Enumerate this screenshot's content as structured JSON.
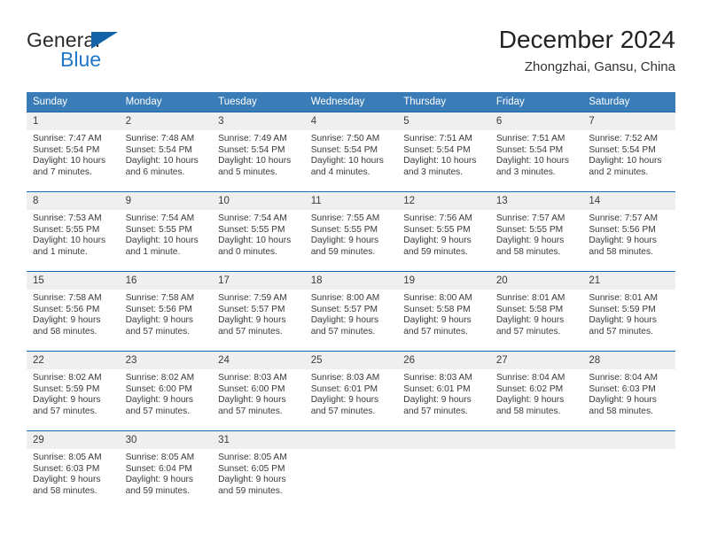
{
  "brand": {
    "name_part1": "General",
    "name_part2": "Blue",
    "accent_color": "#2176c7",
    "triangle_color": "#1263a8"
  },
  "header": {
    "title": "December 2024",
    "subtitle": "Zhongzhai, Gansu, China"
  },
  "calendar": {
    "header_bg": "#3a7cb8",
    "row_divider_color": "#1a69ad",
    "daynum_bg": "#efefef",
    "weekdays": [
      "Sunday",
      "Monday",
      "Tuesday",
      "Wednesday",
      "Thursday",
      "Friday",
      "Saturday"
    ],
    "weeks": [
      [
        {
          "day": "1",
          "sunrise": "Sunrise: 7:47 AM",
          "sunset": "Sunset: 5:54 PM",
          "daylight": "Daylight: 10 hours and 7 minutes."
        },
        {
          "day": "2",
          "sunrise": "Sunrise: 7:48 AM",
          "sunset": "Sunset: 5:54 PM",
          "daylight": "Daylight: 10 hours and 6 minutes."
        },
        {
          "day": "3",
          "sunrise": "Sunrise: 7:49 AM",
          "sunset": "Sunset: 5:54 PM",
          "daylight": "Daylight: 10 hours and 5 minutes."
        },
        {
          "day": "4",
          "sunrise": "Sunrise: 7:50 AM",
          "sunset": "Sunset: 5:54 PM",
          "daylight": "Daylight: 10 hours and 4 minutes."
        },
        {
          "day": "5",
          "sunrise": "Sunrise: 7:51 AM",
          "sunset": "Sunset: 5:54 PM",
          "daylight": "Daylight: 10 hours and 3 minutes."
        },
        {
          "day": "6",
          "sunrise": "Sunrise: 7:51 AM",
          "sunset": "Sunset: 5:54 PM",
          "daylight": "Daylight: 10 hours and 3 minutes."
        },
        {
          "day": "7",
          "sunrise": "Sunrise: 7:52 AM",
          "sunset": "Sunset: 5:54 PM",
          "daylight": "Daylight: 10 hours and 2 minutes."
        }
      ],
      [
        {
          "day": "8",
          "sunrise": "Sunrise: 7:53 AM",
          "sunset": "Sunset: 5:55 PM",
          "daylight": "Daylight: 10 hours and 1 minute."
        },
        {
          "day": "9",
          "sunrise": "Sunrise: 7:54 AM",
          "sunset": "Sunset: 5:55 PM",
          "daylight": "Daylight: 10 hours and 1 minute."
        },
        {
          "day": "10",
          "sunrise": "Sunrise: 7:54 AM",
          "sunset": "Sunset: 5:55 PM",
          "daylight": "Daylight: 10 hours and 0 minutes."
        },
        {
          "day": "11",
          "sunrise": "Sunrise: 7:55 AM",
          "sunset": "Sunset: 5:55 PM",
          "daylight": "Daylight: 9 hours and 59 minutes."
        },
        {
          "day": "12",
          "sunrise": "Sunrise: 7:56 AM",
          "sunset": "Sunset: 5:55 PM",
          "daylight": "Daylight: 9 hours and 59 minutes."
        },
        {
          "day": "13",
          "sunrise": "Sunrise: 7:57 AM",
          "sunset": "Sunset: 5:55 PM",
          "daylight": "Daylight: 9 hours and 58 minutes."
        },
        {
          "day": "14",
          "sunrise": "Sunrise: 7:57 AM",
          "sunset": "Sunset: 5:56 PM",
          "daylight": "Daylight: 9 hours and 58 minutes."
        }
      ],
      [
        {
          "day": "15",
          "sunrise": "Sunrise: 7:58 AM",
          "sunset": "Sunset: 5:56 PM",
          "daylight": "Daylight: 9 hours and 58 minutes."
        },
        {
          "day": "16",
          "sunrise": "Sunrise: 7:58 AM",
          "sunset": "Sunset: 5:56 PM",
          "daylight": "Daylight: 9 hours and 57 minutes."
        },
        {
          "day": "17",
          "sunrise": "Sunrise: 7:59 AM",
          "sunset": "Sunset: 5:57 PM",
          "daylight": "Daylight: 9 hours and 57 minutes."
        },
        {
          "day": "18",
          "sunrise": "Sunrise: 8:00 AM",
          "sunset": "Sunset: 5:57 PM",
          "daylight": "Daylight: 9 hours and 57 minutes."
        },
        {
          "day": "19",
          "sunrise": "Sunrise: 8:00 AM",
          "sunset": "Sunset: 5:58 PM",
          "daylight": "Daylight: 9 hours and 57 minutes."
        },
        {
          "day": "20",
          "sunrise": "Sunrise: 8:01 AM",
          "sunset": "Sunset: 5:58 PM",
          "daylight": "Daylight: 9 hours and 57 minutes."
        },
        {
          "day": "21",
          "sunrise": "Sunrise: 8:01 AM",
          "sunset": "Sunset: 5:59 PM",
          "daylight": "Daylight: 9 hours and 57 minutes."
        }
      ],
      [
        {
          "day": "22",
          "sunrise": "Sunrise: 8:02 AM",
          "sunset": "Sunset: 5:59 PM",
          "daylight": "Daylight: 9 hours and 57 minutes."
        },
        {
          "day": "23",
          "sunrise": "Sunrise: 8:02 AM",
          "sunset": "Sunset: 6:00 PM",
          "daylight": "Daylight: 9 hours and 57 minutes."
        },
        {
          "day": "24",
          "sunrise": "Sunrise: 8:03 AM",
          "sunset": "Sunset: 6:00 PM",
          "daylight": "Daylight: 9 hours and 57 minutes."
        },
        {
          "day": "25",
          "sunrise": "Sunrise: 8:03 AM",
          "sunset": "Sunset: 6:01 PM",
          "daylight": "Daylight: 9 hours and 57 minutes."
        },
        {
          "day": "26",
          "sunrise": "Sunrise: 8:03 AM",
          "sunset": "Sunset: 6:01 PM",
          "daylight": "Daylight: 9 hours and 57 minutes."
        },
        {
          "day": "27",
          "sunrise": "Sunrise: 8:04 AM",
          "sunset": "Sunset: 6:02 PM",
          "daylight": "Daylight: 9 hours and 58 minutes."
        },
        {
          "day": "28",
          "sunrise": "Sunrise: 8:04 AM",
          "sunset": "Sunset: 6:03 PM",
          "daylight": "Daylight: 9 hours and 58 minutes."
        }
      ],
      [
        {
          "day": "29",
          "sunrise": "Sunrise: 8:05 AM",
          "sunset": "Sunset: 6:03 PM",
          "daylight": "Daylight: 9 hours and 58 minutes."
        },
        {
          "day": "30",
          "sunrise": "Sunrise: 8:05 AM",
          "sunset": "Sunset: 6:04 PM",
          "daylight": "Daylight: 9 hours and 59 minutes."
        },
        {
          "day": "31",
          "sunrise": "Sunrise: 8:05 AM",
          "sunset": "Sunset: 6:05 PM",
          "daylight": "Daylight: 9 hours and 59 minutes."
        },
        {
          "day": "",
          "sunrise": "",
          "sunset": "",
          "daylight": ""
        },
        {
          "day": "",
          "sunrise": "",
          "sunset": "",
          "daylight": ""
        },
        {
          "day": "",
          "sunrise": "",
          "sunset": "",
          "daylight": ""
        },
        {
          "day": "",
          "sunrise": "",
          "sunset": "",
          "daylight": ""
        }
      ]
    ]
  }
}
